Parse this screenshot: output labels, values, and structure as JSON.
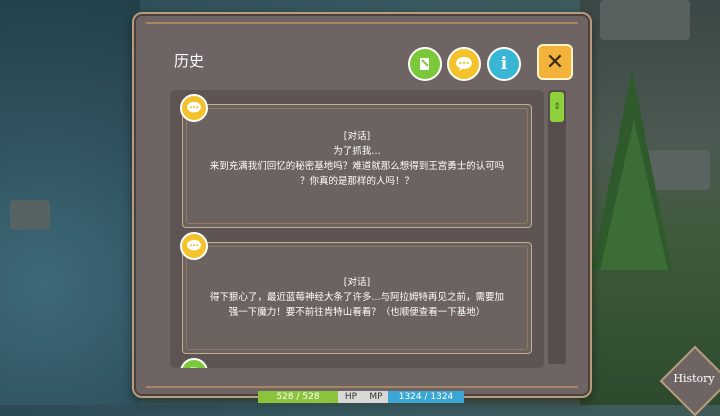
{
  "panel": {
    "title": "历史"
  },
  "toolbar": {
    "log_icon": "scroll-icon",
    "chat_icon": "speech-bubble-icon",
    "info_icon": "info-icon",
    "info_glyph": "i",
    "close_glyph": "✕"
  },
  "entries": [
    {
      "icon": "speech-bubble-icon",
      "lines": [
        "[对话]",
        "为了抓我…",
        "来到充满我们回忆的秘密基地吗？难道就那么想得到王宫勇士的认可吗",
        "？你真的是那样的人吗！？"
      ]
    },
    {
      "icon": "speech-bubble-icon",
      "lines": [
        "[对话]",
        "得下狠心了，最近蓝莓神经大条了许多...与阿拉姆特再见之前，需要加",
        "强一下魔力！要不前往肯特山看看？（也顺便查看一下基地）"
      ]
    }
  ],
  "hud": {
    "hp_value": "528 / 528",
    "hp_label": "HP",
    "mp_label": "MP",
    "mp_value": "1324 / 1324"
  },
  "history_button": {
    "label": "History"
  },
  "colors": {
    "panel": "#6e6463",
    "accent_yellow": "#f4c32b",
    "accent_green": "#7bc93a",
    "accent_blue": "#39b6d6",
    "close_orange": "#f3b23a"
  }
}
